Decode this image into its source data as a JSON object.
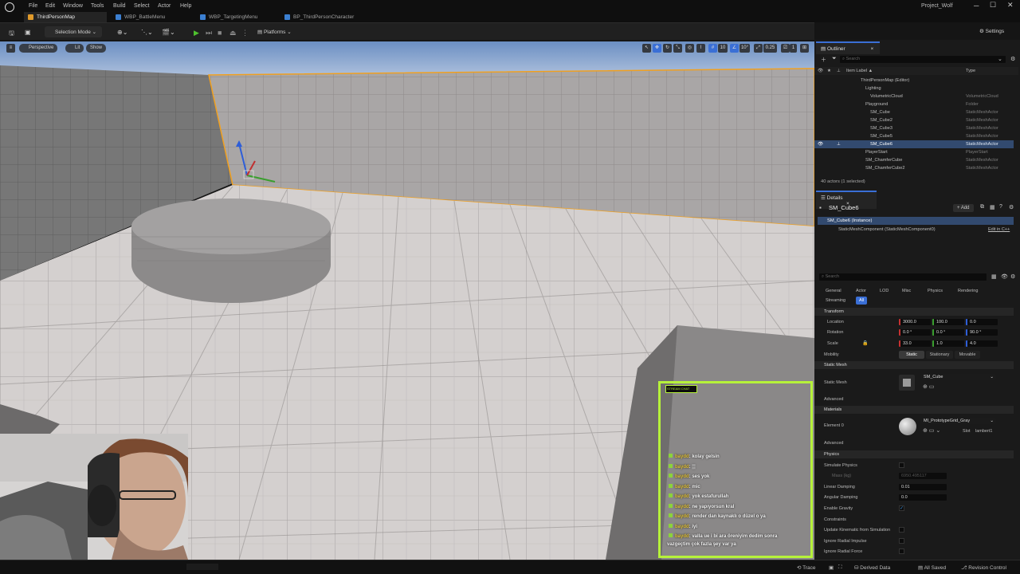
{
  "app": {
    "project_name": "Project_Wolf",
    "window_controls": [
      "minimize-icon",
      "maximize-icon",
      "close-icon"
    ]
  },
  "menu": [
    "File",
    "Edit",
    "Window",
    "Tools",
    "Build",
    "Select",
    "Actor",
    "Help"
  ],
  "tabs": [
    {
      "label": "ThirdPersonMap",
      "active": true
    },
    {
      "label": "WBP_BattleMenu",
      "active": false
    },
    {
      "label": "WBP_TargetingMenu",
      "active": false
    },
    {
      "label": "BP_ThirdPersonCharacter",
      "active": false
    }
  ],
  "toolbar": {
    "selection_mode": "Selection Mode",
    "platforms": "Platforms",
    "settings": "Settings"
  },
  "viewport": {
    "perspective": "Perspective",
    "lit": "Lit",
    "show": "Show",
    "grid_snap": "10",
    "rotate_snap": "10°",
    "scale_snap": "0.25",
    "camera_speed": "1"
  },
  "outliner": {
    "title": "Outliner",
    "search_placeholder": "Search",
    "col_label": "Item Label ▲",
    "col_type": "Type",
    "rows": [
      {
        "label": "ThirdPersonMap (Editor)",
        "type": "",
        "indent": 1
      },
      {
        "label": "Lighting",
        "type": "",
        "indent": 2
      },
      {
        "label": "VolumetricCloud",
        "type": "VolumetricCloud",
        "indent": 3
      },
      {
        "label": "Playground",
        "type": "Folder",
        "indent": 2
      },
      {
        "label": "SM_Cube",
        "type": "StaticMeshActor",
        "indent": 3
      },
      {
        "label": "SM_Cube2",
        "type": "StaticMeshActor",
        "indent": 3
      },
      {
        "label": "SM_Cube3",
        "type": "StaticMeshActor",
        "indent": 3
      },
      {
        "label": "SM_Cube5",
        "type": "StaticMeshActor",
        "indent": 3
      },
      {
        "label": "SM_Cube6",
        "type": "StaticMeshActor",
        "indent": 3,
        "selected": true
      },
      {
        "label": "PlayerStart",
        "type": "PlayerStart",
        "indent": 2
      },
      {
        "label": "SM_ChamferCube",
        "type": "StaticMeshActor",
        "indent": 2
      },
      {
        "label": "SM_ChamferCube2",
        "type": "StaticMeshActor",
        "indent": 2
      }
    ],
    "footer": "40 actors (1 selected)"
  },
  "details": {
    "title": "Details",
    "actor_name": "SM_Cube6",
    "add_label": "+ Add",
    "instance_row": "SM_Cube6 (Instance)",
    "component_row": "StaticMeshComponent (StaticMeshComponent0)",
    "edit_cpp": "Edit in C++",
    "search_placeholder": "Search",
    "filter_tabs": [
      "General",
      "Actor",
      "LOD",
      "Misc",
      "Physics",
      "Rendering"
    ],
    "filter_tabs2": [
      "Streaming",
      "All"
    ],
    "transform": {
      "section": "Transform",
      "location_label": "Location",
      "location": [
        "3000.0",
        "100.0",
        "0.0"
      ],
      "rotation_label": "Rotation",
      "rotation": [
        "0.0 °",
        "0.0 °",
        "90.0 °"
      ],
      "scale_label": "Scale",
      "scale": [
        "33.0",
        "1.0",
        "4.0"
      ],
      "mobility_label": "Mobility",
      "mobility": [
        "Static",
        "Stationary",
        "Movable"
      ]
    },
    "static_mesh": {
      "section": "Static Mesh",
      "label": "Static Mesh",
      "value": "SM_Cube",
      "advanced": "Advanced"
    },
    "materials": {
      "section": "Materials",
      "label": "Element 0",
      "value": "MI_PrototypeGrid_Gray",
      "slot_label": "Slot",
      "slot_value": "lambert1",
      "advanced": "Advanced"
    },
    "physics": {
      "section": "Physics",
      "simulate": "Simulate Physics",
      "mass": "Mass (kg)",
      "mass_value": "6950.495117",
      "linear": "Linear Damping",
      "linear_value": "0.01",
      "angular": "Angular Damping",
      "angular_value": "0.0",
      "gravity": "Enable Gravity",
      "constraints": "Constraints",
      "kinematic": "Update Kinematic from Simulation",
      "radial_impulse": "Ignore Radial Impulse",
      "radial_force": "Ignore Radial Force"
    }
  },
  "status": {
    "trace": "Trace",
    "derived": "Derived Data",
    "saved": "All Saved",
    "revision": "Revision Control"
  },
  "chat": {
    "header": "STREAM CHAT",
    "messages": [
      {
        "user": "baydd",
        "text": ": kolay gelsin"
      },
      {
        "user": "baydd",
        "text": ": ▒"
      },
      {
        "user": "baydd",
        "text": ": ses yok"
      },
      {
        "user": "baydd",
        "text": ": mic"
      },
      {
        "user": "baydd",
        "text": ": yok estafurullah"
      },
      {
        "user": "baydd",
        "text": ": ne yapıyorsun kral"
      },
      {
        "user": "baydd",
        "text": ": render dan kaynaklı o düzel o ya"
      },
      {
        "user": "baydd",
        "text": ": iyi"
      },
      {
        "user": "baydd",
        "text": ": valla ue i bi ara öreniyim dedim sonra"
      },
      {
        "user": "",
        "text": "vazgeçtim çok fazla şey var ya"
      }
    ]
  },
  "colors": {
    "accent": "#3a6fd6",
    "selection": "#f0a020",
    "chat_border": "#b6f23a"
  }
}
